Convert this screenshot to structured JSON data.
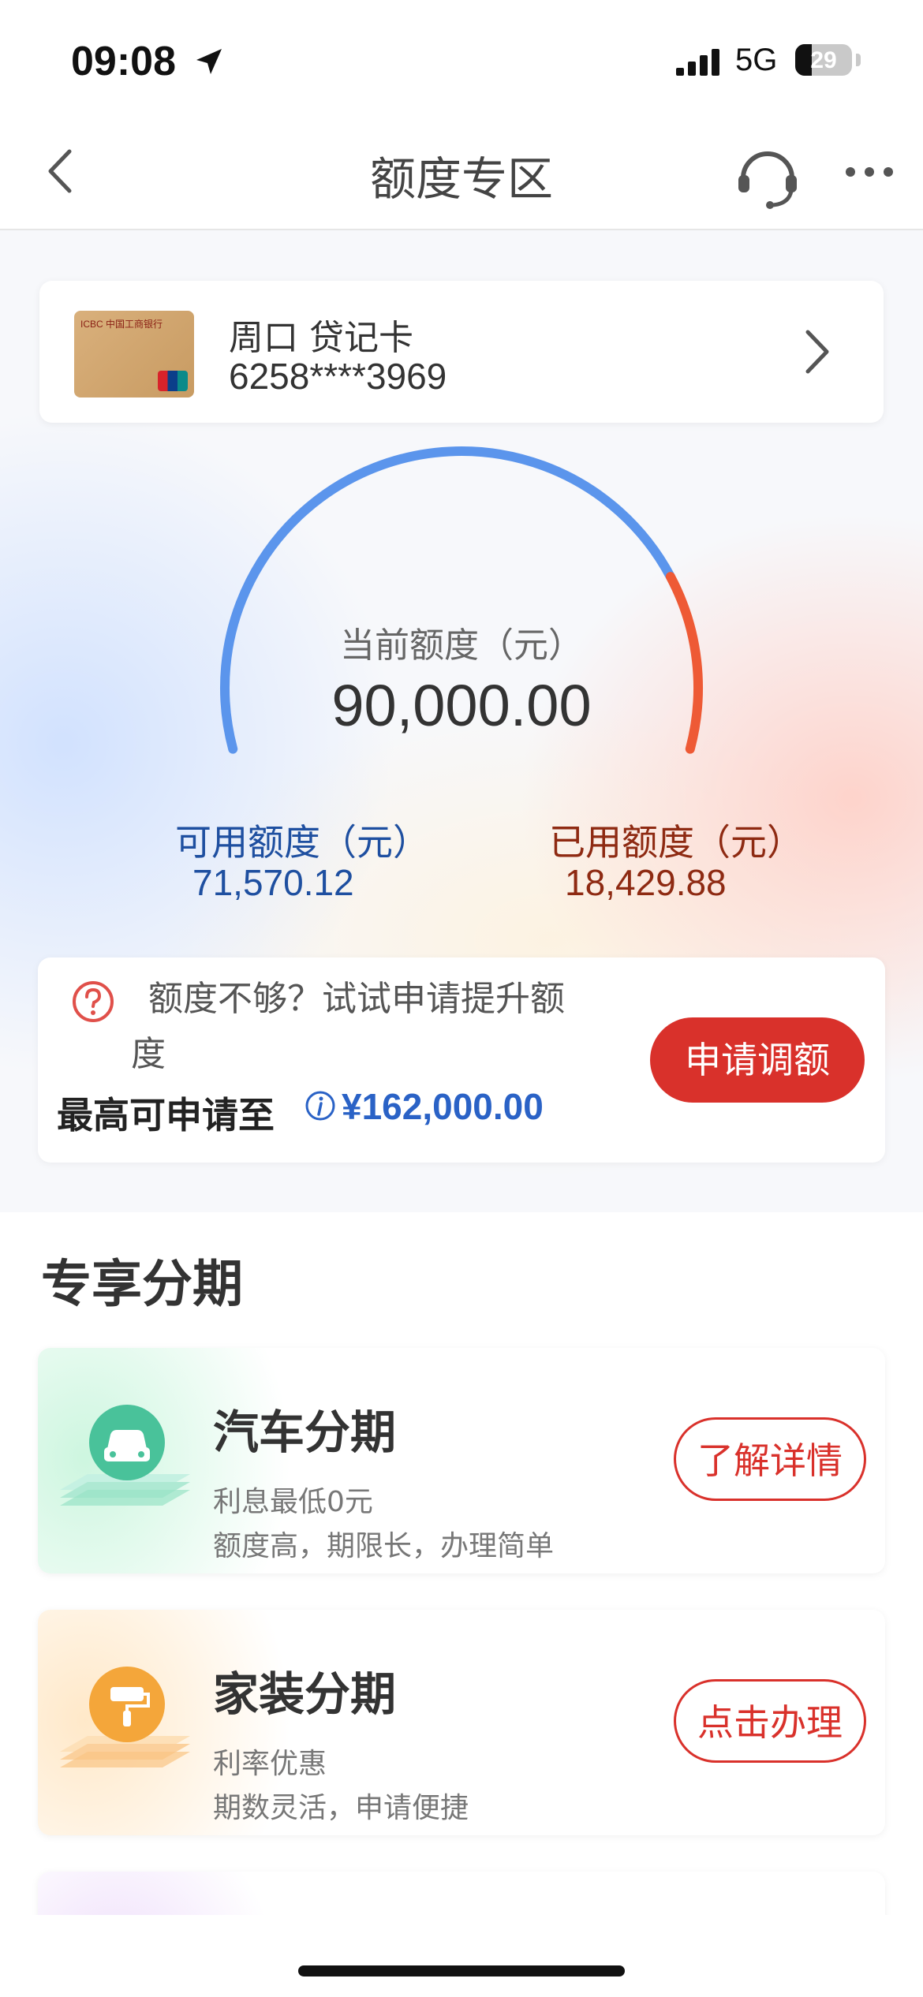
{
  "status_bar": {
    "time": "09:08",
    "network": "5G",
    "battery": "29",
    "battery_level": 0.29
  },
  "nav": {
    "title": "额度专区"
  },
  "card": {
    "name": "周口 贷记卡",
    "number": "6258****3969",
    "thumb_brand": "ICBC 中国工商银行"
  },
  "gauge": {
    "label": "当前额度（元）",
    "total": "90,000.00",
    "available_label": "可用额度（元）",
    "available": "71,570.12",
    "used_label": "已用额度（元）",
    "used": "18,429.88",
    "available_fraction": 0.7952,
    "colors": {
      "available": "#5b95ec",
      "used": "#ee5a35"
    }
  },
  "upgrade": {
    "prompt_line1": "额度不够？试试申请提升额",
    "prompt_line2": "度",
    "max_label": "最高可申请至",
    "max_value": "¥162,000.00",
    "button": "申请调额"
  },
  "section": {
    "title": "专享分期",
    "products": [
      {
        "title": "汽车分期",
        "sub1": "利息最低0元",
        "sub2": "额度高，期限长，办理简单",
        "button": "了解详情",
        "icon": "car-icon",
        "color": "#49c29a"
      },
      {
        "title": "家装分期",
        "sub1": "利率优惠",
        "sub2": "期数灵活，申请便捷",
        "button": "点击办理",
        "icon": "paint-roller-icon",
        "color": "#f4a63a"
      }
    ]
  }
}
